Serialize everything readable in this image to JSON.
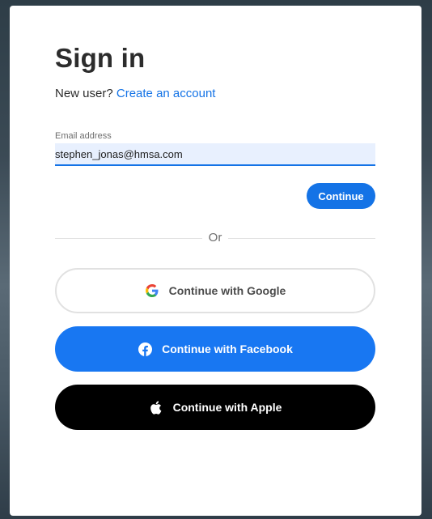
{
  "signin": {
    "title": "Sign in",
    "new_user_text": "New user?",
    "create_account_link": "Create an account",
    "email_label": "Email address",
    "email_value": "stephen_jonas@hmsa.com",
    "continue_label": "Continue",
    "divider_text": "Or"
  },
  "social": {
    "google_label": "Continue with Google",
    "facebook_label": "Continue with Facebook",
    "apple_label": "Continue with Apple"
  },
  "colors": {
    "accent": "#1473e6",
    "facebook": "#1877f2",
    "apple": "#000000"
  },
  "icons": {
    "google": "google-icon",
    "facebook": "facebook-icon",
    "apple": "apple-icon"
  }
}
